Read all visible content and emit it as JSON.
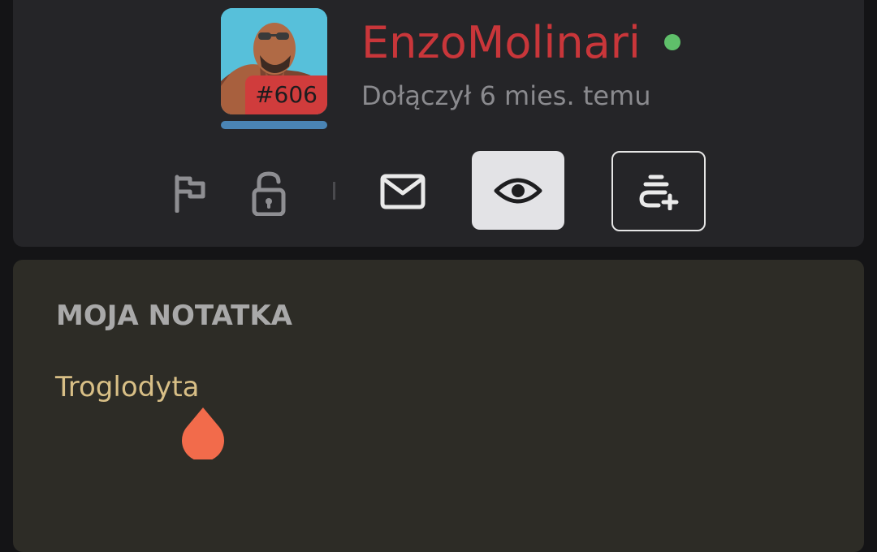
{
  "profile": {
    "username": "EnzoMolinari",
    "rank_badge": "#606",
    "joined": "Dołączył 6 mies. temu",
    "online": true,
    "colors": {
      "username": "#c9363a",
      "online": "#5fbf6a",
      "rank_badge": "#d03c3c",
      "level_bar": "#4a84b4"
    }
  },
  "actions": {
    "report": {
      "icon": "flag-icon"
    },
    "block": {
      "icon": "lock-open-icon"
    },
    "message": {
      "icon": "mail-icon"
    },
    "watch": {
      "icon": "eye-icon",
      "active": true
    },
    "add_to_list": {
      "icon": "add-to-list-icon"
    }
  },
  "note": {
    "title": "MOJA NOTATKA",
    "text": "Troglodyta",
    "colors": {
      "text": "#d8bf86",
      "caret_handle": "#f26b4b"
    }
  }
}
